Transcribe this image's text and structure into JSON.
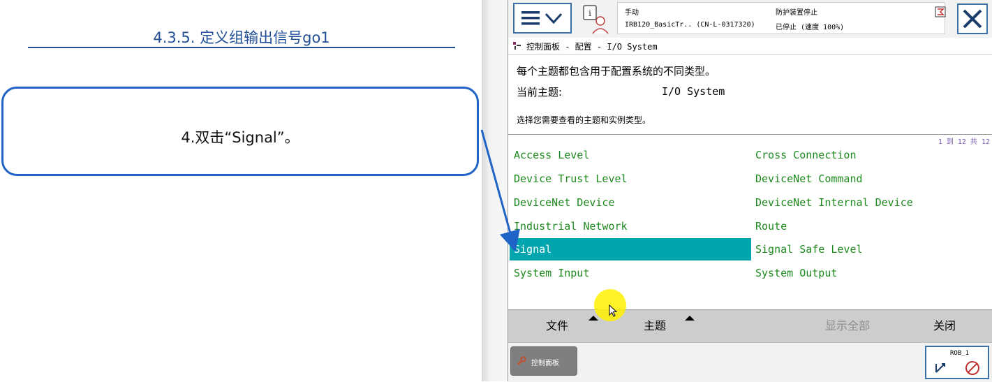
{
  "slide": {
    "title": "4.3.5. 定义组输出信号go1",
    "instruction": "4.双击“Signal”。"
  },
  "pendant": {
    "status": {
      "mode": "手动",
      "controller": "IRB120_BasicTr.. (CN-L-0317320)",
      "safety_title": "防护装置停止",
      "safety_state": "已停止 (速度 100%)"
    },
    "breadcrumb": "控制面板 - 配置 - I/O System",
    "info": {
      "description": "每个主题都包含用于配置系统的不同类型。",
      "current_topic_label": "当前主题:",
      "current_topic_value": "I/O System",
      "hint": "选择您需要查看的主题和实例类型。"
    },
    "list_range": "1 到 12 共 12",
    "items": [
      {
        "label": "Access Level",
        "selected": false
      },
      {
        "label": "Cross Connection",
        "selected": false
      },
      {
        "label": "Device Trust Level",
        "selected": false
      },
      {
        "label": "DeviceNet Command",
        "selected": false
      },
      {
        "label": "DeviceNet Device",
        "selected": false
      },
      {
        "label": "DeviceNet Internal Device",
        "selected": false
      },
      {
        "label": "Industrial Network",
        "selected": false
      },
      {
        "label": "Route",
        "selected": false
      },
      {
        "label": "Signal",
        "selected": true
      },
      {
        "label": "Signal Safe Level",
        "selected": false
      },
      {
        "label": "System Input",
        "selected": false
      },
      {
        "label": "System Output",
        "selected": false
      }
    ],
    "commands": {
      "file": "文件",
      "topic": "主题",
      "show_all": "显示全部",
      "close": "关闭"
    },
    "taskbar": {
      "control_panel": "控制面板",
      "rob": "ROB_1"
    },
    "colors": {
      "selection": "#00a5ad",
      "item_text": "#1d8a1d",
      "accent": "#1f4e96"
    },
    "icons": [
      "menu-icon",
      "chevron-down-icon",
      "operator-icon",
      "close-icon",
      "wrench-icon",
      "coordinate-axes-icon"
    ]
  }
}
